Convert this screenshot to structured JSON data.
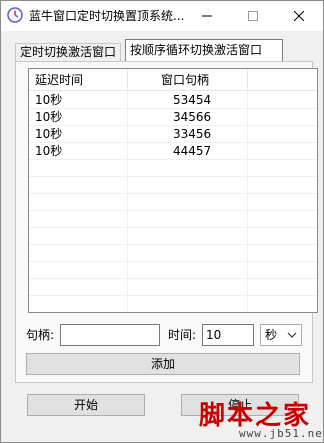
{
  "window": {
    "title": "蓝牛窗口定时切换置顶系统..."
  },
  "tabs": [
    {
      "label": "定时切换激活窗口",
      "active": false
    },
    {
      "label": "按顺序循环切换激活窗口",
      "active": true
    }
  ],
  "list": {
    "columns": [
      "延迟时间",
      "窗口句柄"
    ],
    "rows": [
      {
        "delay": "10秒",
        "handle": "53454"
      },
      {
        "delay": "10秒",
        "handle": "34566"
      },
      {
        "delay": "10秒",
        "handle": "33456"
      },
      {
        "delay": "10秒",
        "handle": "44457"
      }
    ]
  },
  "form": {
    "handle_label": "句柄:",
    "handle_value": "",
    "time_label": "时间:",
    "time_value": "10",
    "unit_value": "秒",
    "add_label": "添加"
  },
  "footer": {
    "start_label": "开始",
    "stop_label": "停止"
  },
  "watermark": {
    "text": "脚本之家",
    "url": "www.jb51.net"
  },
  "colors": {
    "window_bg": "#f0f0f0",
    "watermark_red": "#c80000"
  },
  "icons": {
    "app": "app-clock-icon",
    "minimize": "minimize-icon",
    "maximize": "maximize-icon",
    "close": "close-icon",
    "dropdown": "chevron-down-icon"
  }
}
